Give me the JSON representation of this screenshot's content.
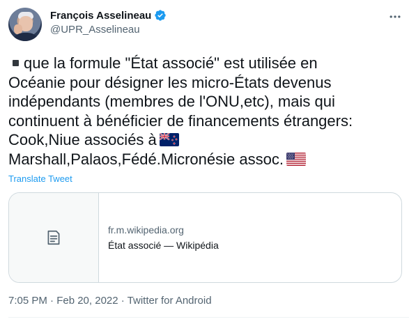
{
  "author": {
    "display_name": "François Asselineau",
    "handle": "@UPR_Asselineau",
    "verified_icon": "verified-badge-icon",
    "accent_color": "#1d9bf0"
  },
  "tweet": {
    "lines": [
      "que la formule \"État associé\" est utilisée en",
      "Océanie pour désigner les micro-États devenus",
      "indépendants (membres de l'ONU,etc), mais qui",
      "continuent à bénéficier de financements étrangers:",
      "Cook,Niue associés à",
      "Marshall,Palaos,Fédé.Micronésie assoc."
    ],
    "flags": [
      "new-zealand-flag-icon",
      "united-states-flag-icon"
    ]
  },
  "translate_label": "Translate Tweet",
  "card": {
    "domain": "fr.m.wikipedia.org",
    "title": "État associé — Wikipédia",
    "thumb_icon": "document-icon"
  },
  "meta": {
    "timestamp": "7:05 PM · Feb 20, 2022 · Twitter for Android"
  }
}
